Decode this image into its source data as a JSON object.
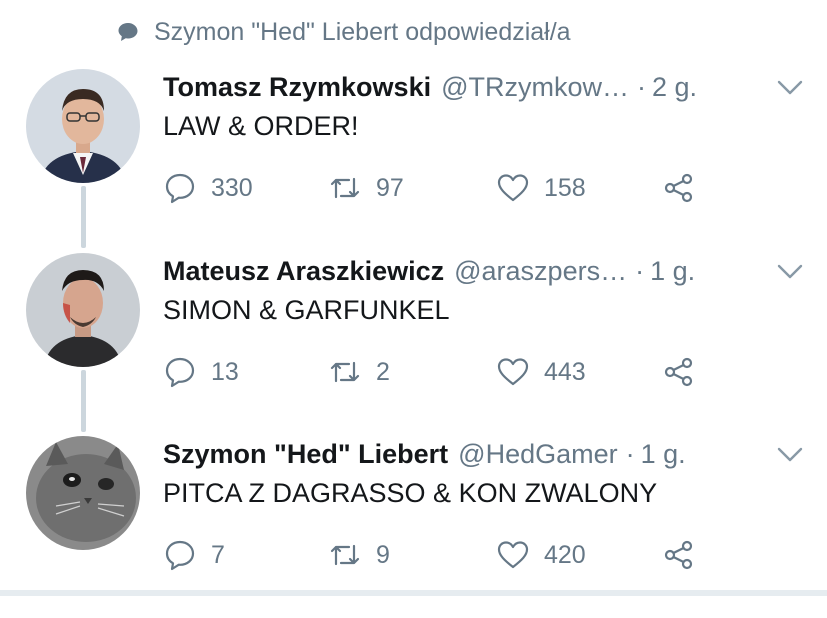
{
  "context": {
    "text": "Szymon \"Hed\" Liebert odpowiedział/a",
    "icon": "speech-bubble-icon"
  },
  "colors": {
    "secondary_text": "#657786",
    "primary_text": "#14171a",
    "thread_line": "#ccd6dd"
  },
  "tweets": [
    {
      "name": "Tomasz Rzymkowski",
      "handle": "@TRzymkow…",
      "separator": "·",
      "time": "2 g.",
      "text": "LAW & ORDER!",
      "replies": "330",
      "retweets": "97",
      "likes": "158"
    },
    {
      "name": "Mateusz Araszkiewicz",
      "handle": "@araszpers…",
      "separator": "·",
      "time": "1 g.",
      "text": "SIMON & GARFUNKEL",
      "replies": "13",
      "retweets": "2",
      "likes": "443"
    },
    {
      "name": "Szymon \"Hed\" Liebert",
      "handle": "@HedGamer",
      "separator": "·",
      "time": "1 g.",
      "text": "PITCA Z DAGRASSO & KON ZWALONY",
      "replies": "7",
      "retweets": "9",
      "likes": "420"
    }
  ]
}
